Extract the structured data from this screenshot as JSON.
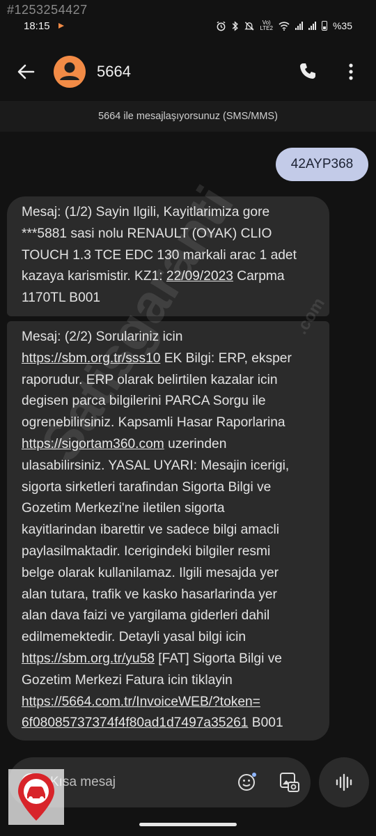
{
  "watermark": {
    "id": "#1253254427",
    "site": "Satisgaranti",
    "site_suffix": ".com"
  },
  "status_bar": {
    "time": "18:15",
    "battery": "%35",
    "network": "Vo) LTE2"
  },
  "header": {
    "contact": "5664"
  },
  "banner": {
    "text": "5664 ile mesajlaşıyorsunuz (SMS/MMS)"
  },
  "messages": {
    "sent": {
      "text": "42AYP368"
    },
    "received_1": {
      "lines": [
        "Mesaj: (1/2) Sayin Ilgili, Kayitlarimiza gore",
        "***5881 sasi nolu RENAULT (OYAK) CLIO",
        "TOUCH 1.3 TCE EDC 130 markali arac 1 adet",
        "kazaya karismistir. KZ1: ",
        "22/09/2023",
        " Carpma",
        "1170TL B001"
      ]
    },
    "received_2": {
      "lines": [
        "Mesaj: (2/2) Sorulariniz icin",
        "https://sbm.org.tr/sss10",
        " EK Bilgi: ERP, eksper",
        "raporudur. ERP olarak belirtilen kazalar icin",
        "degisen parca bilgilerini PARCA Sorgu ile",
        "ogrenebilirsiniz. Kapsamli Hasar Raporlarina",
        "https://sigortam360.com",
        " uzerinden",
        "ulasabilirsiniz. YASAL UYARI: Mesajin icerigi,",
        "sigorta sirketleri tarafindan Sigorta Bilgi ve",
        "Gozetim Merkezi'ne iletilen sigorta",
        "kayitlarindan ibarettir ve sadece bilgi amacli",
        "paylasilmaktadir. Icerigindeki bilgiler resmi",
        "belge olarak kullanilamaz. Ilgili mesajda yer",
        "alan tutara, trafik ve kasko hasarlarinda yer",
        "alan dava faizi ve yargilama giderleri dahil",
        "edilmemektedir. Detayli yasal bilgi icin",
        "https://sbm.org.tr/yu58",
        " [FAT] Sigorta Bilgi ve",
        "Gozetim Merkezi Fatura icin tiklayin",
        "https://5664.com.tr/InvoiceWEB/?token=",
        "6f08085737374f4f80ad1d7497a35261",
        " B001"
      ]
    }
  },
  "composer": {
    "placeholder": "Kısa mesaj"
  },
  "colors": {
    "background": "#121212",
    "bubble": "#2b2b2b",
    "sent_bubble": "#c3cbe8",
    "avatar": "#f28b46"
  }
}
